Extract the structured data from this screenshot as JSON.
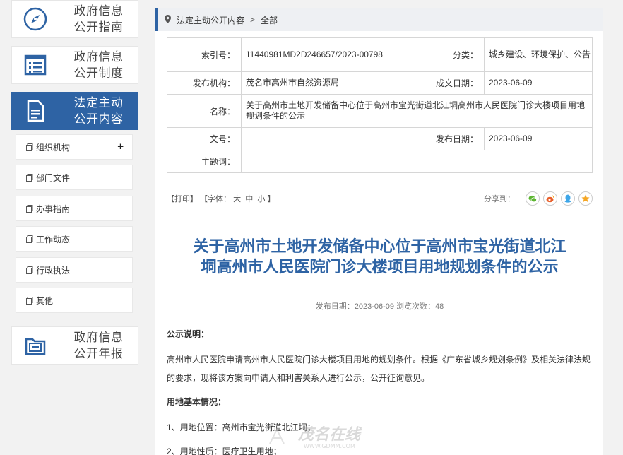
{
  "sidebar": {
    "cards": [
      {
        "label_l1": "政府信息",
        "label_l2": "公开指南",
        "icon": "compass-icon"
      },
      {
        "label_l1": "政府信息",
        "label_l2": "公开制度",
        "icon": "list-icon"
      },
      {
        "label_l1": "法定主动",
        "label_l2": "公开内容",
        "icon": "document-icon"
      },
      {
        "label_l1": "政府信息",
        "label_l2": "公开年报",
        "icon": "folder-icon"
      }
    ],
    "sub_items": [
      "组织机构",
      "部门文件",
      "办事指南",
      "工作动态",
      "行政执法",
      "其他"
    ],
    "expand_symbol": "+"
  },
  "breadcrumb": {
    "items": [
      "法定主动公开内容",
      "全部"
    ],
    "separator": ">"
  },
  "meta": {
    "index_label": "索引号：",
    "index_value": "11440981MD2D246657/2023-00798",
    "category_label": "分类：",
    "category_value": "城乡建设、环境保护、公告",
    "publisher_label": "发布机构：",
    "publisher_value": "茂名市高州市自然资源局",
    "written_label": "成文日期：",
    "written_value": "2023-06-09",
    "name_label": "名称：",
    "name_value": "关于高州市土地开发储备中心位于高州市宝光街道北江垌高州市人民医院门诊大楼项目用地规划条件的公示",
    "docno_label": "文号：",
    "docno_value": "",
    "pubdate_label": "发布日期：",
    "pubdate_value": "2023-06-09",
    "keywords_label": "主题词：",
    "keywords_value": ""
  },
  "tools": {
    "print": "【打印】",
    "font_prefix": "【字体：",
    "font_large": "大",
    "font_medium": "中",
    "font_small": "小",
    "font_suffix": "】",
    "share_label": "分享到："
  },
  "article": {
    "title_l1": "关于高州市土地开发储备中心位于高州市宝光街道北江",
    "title_l2": "垌高州市人民医院门诊大楼项目用地规划条件的公示",
    "info": "发布日期：2023-06-09  浏览次数：48",
    "h1": "公示说明：",
    "p1_l1": "高州市人民医院申请高州市人民医院门诊大楼项目用地的规划条件。根据《广东省城乡规划条例》及相关法律法规",
    "p1_l2": "的要求，现将该方案向申请人和利害关系人进行公示，公开征询意见。",
    "h2": "用地基本情况：",
    "p2": "1、用地位置：高州市宝光街道北江垌；",
    "p3": "2、用地性质：医疗卫生用地；"
  },
  "watermark": {
    "text": "茂名在线",
    "url_text": "WWW.GDMM.COM"
  },
  "colors": {
    "brand": "#2e63a4",
    "wechat": "#5cb531",
    "weibo": "#e8602c",
    "qq": "#3ea6e8",
    "fav": "#f5a623"
  }
}
